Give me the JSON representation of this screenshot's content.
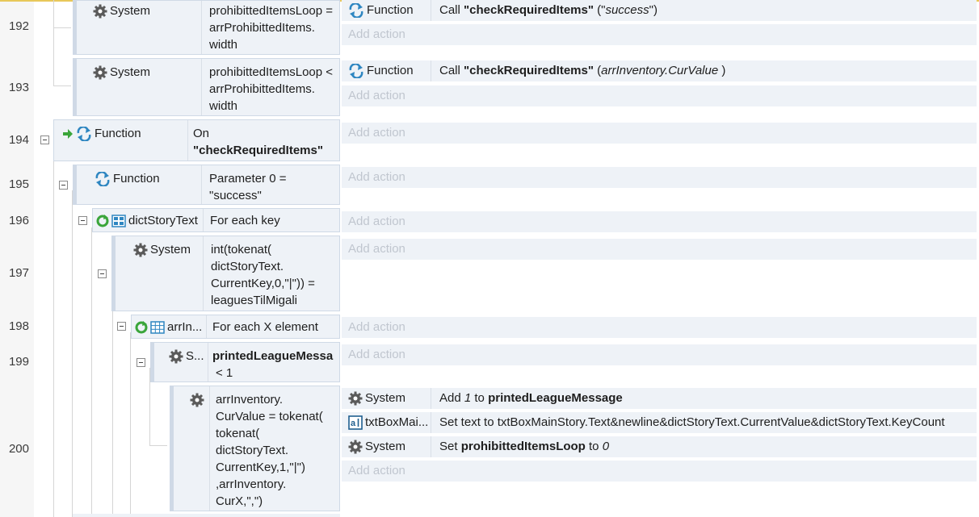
{
  "lines": [
    "192",
    "193",
    "194",
    "195",
    "196",
    "197",
    "198",
    "199",
    "200"
  ],
  "add_action": "Add action",
  "e192": {
    "object": "System",
    "cond": "prohibittedItemsLoop = arrProhibittedItems. width",
    "action": {
      "object": "Function",
      "prefix": "Call ",
      "name": "\"checkRequiredItems\"",
      "open": " (\"",
      "param": "success",
      "close": "\")"
    }
  },
  "e193": {
    "object": "System",
    "cond": "prohibittedItemsLoop < arrProhibittedItems. width",
    "action": {
      "object": "Function",
      "prefix": "Call ",
      "name": "\"checkRequiredItems\"",
      "open": " (",
      "param": "arrInventory.CurValue",
      "close": " )"
    }
  },
  "e194": {
    "object": "Function",
    "cond_line1": "On",
    "cond_line2": "\"checkRequiredItems\""
  },
  "e195": {
    "object": "Function",
    "cond": "Parameter 0 = \"success\""
  },
  "e196": {
    "object": "dictStoryText",
    "cond": "For each key"
  },
  "e197": {
    "object": "System",
    "cond": "int(tokenat( dictStoryText. CurrentKey,0,\"|\")) = leaguesTilMigali"
  },
  "e198": {
    "object": "arrIn...",
    "cond": "For each X element"
  },
  "e199": {
    "object": "S...",
    "cond_bold": "printedLeagueMessa",
    "cond_rest": "< 1"
  },
  "e200": {
    "cond": "arrInventory. CurValue = tokenat( tokenat( dictStoryText. CurrentKey,1,\"|\") ,arrInventory. CurX,\",\")",
    "actions": [
      {
        "object": "System",
        "t1": "Add ",
        "v1": "1",
        "t2": " to ",
        "v2": "printedLeagueMessage"
      },
      {
        "object": "txtBoxMai...",
        "text": "Set text to txtBoxMainStory.Text&newline&dictStoryText.CurrentValue&dictStoryText.KeyCount"
      },
      {
        "object": "System",
        "t1": "Set ",
        "v1": "prohibittedItemsLoop",
        "t2": " to ",
        "v2": "0"
      }
    ]
  },
  "colors": {
    "accent": "#2e86c1",
    "event_bg": "#eef2f7",
    "event_border": "#cfd9e6",
    "placeholder": "#c0c6cf",
    "arrow_green": "#3aa53a"
  }
}
